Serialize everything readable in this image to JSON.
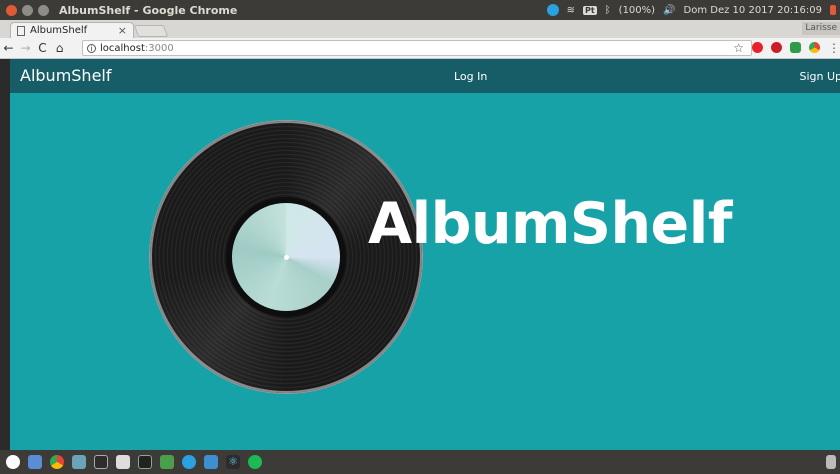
{
  "os": {
    "window_title": "AlbumShelf - Google Chrome",
    "keyboard": "Pt",
    "battery": "(100%)",
    "datetime": "Dom Dez 10 2017 20:16:09"
  },
  "browser": {
    "tab_title": "AlbumShelf",
    "tab_close": "×",
    "profile": "Larisse",
    "url_host": "localhost",
    "url_port": ":3000",
    "back": "←",
    "forward": "→",
    "reload": "C",
    "home": "⌂",
    "info": "i",
    "star": "☆",
    "menu": "⋮"
  },
  "navbar": {
    "brand": "AlbumShelf",
    "login": "Log In",
    "signup": "Sign Up"
  },
  "hero": {
    "title": "AlbumShelf"
  },
  "dock": {
    "react_glyph": "⚛"
  }
}
